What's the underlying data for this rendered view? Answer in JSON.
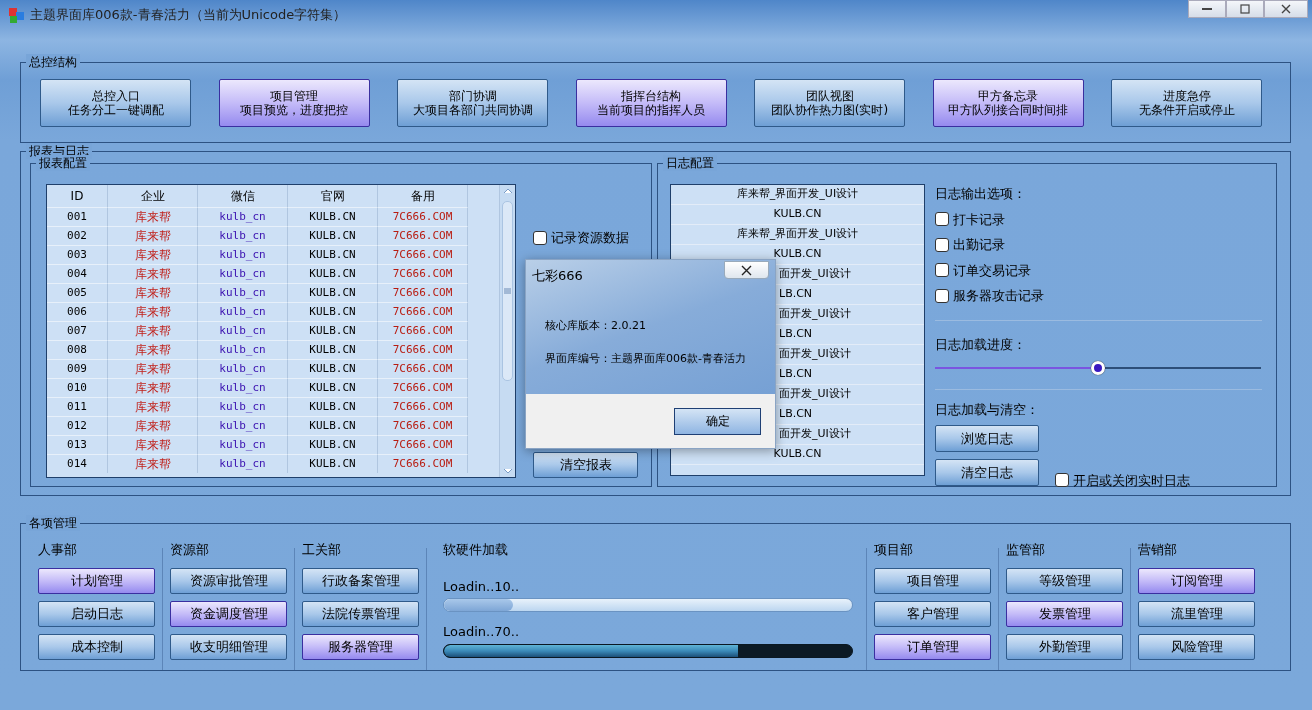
{
  "window": {
    "title": "主题界面库006款-青春活力（当前为Unicode字符集）"
  },
  "top_group": {
    "title": "总控结构",
    "buttons": [
      {
        "line1": "总控入口",
        "line2": "任务分工一键调配",
        "highlighted": false
      },
      {
        "line1": "项目管理",
        "line2": "项目预览，进度把控",
        "highlighted": true
      },
      {
        "line1": "部门协调",
        "line2": "大项目各部门共同协调",
        "highlighted": false
      },
      {
        "line1": "指挥台结构",
        "line2": "当前项目的指挥人员",
        "highlighted": true
      },
      {
        "line1": "团队视图",
        "line2": "团队协作热力图(实时)",
        "highlighted": false
      },
      {
        "line1": "甲方备忘录",
        "line2": "甲方队列接合同时间排",
        "highlighted": true
      },
      {
        "line1": "进度急停",
        "line2": "无条件开启或停止",
        "highlighted": false
      }
    ]
  },
  "report_log": {
    "title": "报表与日志",
    "report": {
      "title": "报表配置",
      "table": {
        "columns": [
          "ID",
          "企业",
          "微信",
          "官网",
          "备用"
        ],
        "rows": [
          [
            "001",
            "库来帮",
            "kulb_cn",
            "KULB.CN",
            "7C666.COM"
          ],
          [
            "002",
            "库来帮",
            "kulb_cn",
            "KULB.CN",
            "7C666.COM"
          ],
          [
            "003",
            "库来帮",
            "kulb_cn",
            "KULB.CN",
            "7C666.COM"
          ],
          [
            "004",
            "库来帮",
            "kulb_cn",
            "KULB.CN",
            "7C666.COM"
          ],
          [
            "005",
            "库来帮",
            "kulb_cn",
            "KULB.CN",
            "7C666.COM"
          ],
          [
            "006",
            "库来帮",
            "kulb_cn",
            "KULB.CN",
            "7C666.COM"
          ],
          [
            "007",
            "库来帮",
            "kulb_cn",
            "KULB.CN",
            "7C666.COM"
          ],
          [
            "008",
            "库来帮",
            "kulb_cn",
            "KULB.CN",
            "7C666.COM"
          ],
          [
            "009",
            "库来帮",
            "kulb_cn",
            "KULB.CN",
            "7C666.COM"
          ],
          [
            "010",
            "库来帮",
            "kulb_cn",
            "KULB.CN",
            "7C666.COM"
          ],
          [
            "011",
            "库来帮",
            "kulb_cn",
            "KULB.CN",
            "7C666.COM"
          ],
          [
            "012",
            "库来帮",
            "kulb_cn",
            "KULB.CN",
            "7C666.COM"
          ],
          [
            "013",
            "库来帮",
            "kulb_cn",
            "KULB.CN",
            "7C666.COM"
          ],
          [
            "014",
            "库来帮",
            "kulb_cn",
            "KULB.CN",
            "7C666.COM"
          ]
        ]
      },
      "checkboxes": [
        {
          "label": "记录资源数据",
          "checked": false
        }
      ],
      "clear_button": "清空报表"
    },
    "log": {
      "title": "日志配置",
      "list": [
        {
          "text": "库来帮_界面开发_UI设计",
          "kind": "full"
        },
        {
          "text": "KULB.CN",
          "kind": "full"
        },
        {
          "text": "库来帮_界面开发_UI设计",
          "kind": "full"
        },
        {
          "text": "KULB.CN",
          "kind": "full"
        },
        {
          "text": "面开发_UI设计",
          "kind": "partial"
        },
        {
          "text": "LB.CN",
          "kind": "partial"
        },
        {
          "text": "面开发_UI设计",
          "kind": "partial"
        },
        {
          "text": "LB.CN",
          "kind": "partial"
        },
        {
          "text": "面开发_UI设计",
          "kind": "partial"
        },
        {
          "text": "LB.CN",
          "kind": "partial"
        },
        {
          "text": "面开发_UI设计",
          "kind": "partial"
        },
        {
          "text": "LB.CN",
          "kind": "partial"
        },
        {
          "text": "面开发_UI设计",
          "kind": "partial"
        },
        {
          "text": "KULB.CN",
          "kind": "full"
        }
      ],
      "output_title": "日志输出选项：",
      "options": [
        {
          "label": "打卡记录",
          "checked": false
        },
        {
          "label": "出勤记录",
          "checked": false
        },
        {
          "label": "订单交易记录",
          "checked": false
        },
        {
          "label": "服务器攻击记录",
          "checked": false
        }
      ],
      "progress_title": "日志加载进度：",
      "slider": {
        "level": 0.5
      },
      "load_title": "日志加载与清空：",
      "buttons": [
        "浏览日志",
        "清空日志"
      ],
      "realtime": {
        "label": "开启或关闭实时日志",
        "checked": false
      }
    }
  },
  "management": {
    "title": "各项管理",
    "left_departments": [
      {
        "name": "人事部",
        "buttons": [
          {
            "label": "计划管理",
            "highlighted": true
          },
          {
            "label": "启动日志",
            "highlighted": false
          },
          {
            "label": "成本控制",
            "highlighted": false
          }
        ]
      },
      {
        "name": "资源部",
        "buttons": [
          {
            "label": "资源审批管理",
            "highlighted": false
          },
          {
            "label": "资金调度管理",
            "highlighted": true
          },
          {
            "label": "收支明细管理",
            "highlighted": false
          }
        ]
      },
      {
        "name": "工关部",
        "buttons": [
          {
            "label": "行政备案管理",
            "highlighted": false
          },
          {
            "label": "法院传票管理",
            "highlighted": false
          },
          {
            "label": "服务器管理",
            "highlighted": true
          }
        ]
      }
    ],
    "loading": {
      "title": "软硬件加载",
      "bars": [
        {
          "label": "Loadin..10..",
          "level": 0.17,
          "kind": "light"
        },
        {
          "label": "Loadin..70..",
          "level": 0.72,
          "kind": "dark"
        }
      ]
    },
    "right_departments": [
      {
        "name": "项目部",
        "buttons": [
          {
            "label": "项目管理",
            "highlighted": false
          },
          {
            "label": "客户管理",
            "highlighted": false
          },
          {
            "label": "订单管理",
            "highlighted": true
          }
        ]
      },
      {
        "name": "监管部",
        "buttons": [
          {
            "label": "等级管理",
            "highlighted": false
          },
          {
            "label": "发票管理",
            "highlighted": true
          },
          {
            "label": "外勤管理",
            "highlighted": false
          }
        ]
      },
      {
        "name": "营销部",
        "buttons": [
          {
            "label": "订阅管理",
            "highlighted": true
          },
          {
            "label": "流里管理",
            "highlighted": false
          },
          {
            "label": "风险管理",
            "highlighted": false
          }
        ]
      }
    ]
  },
  "dialog": {
    "title": "七彩666",
    "lines": [
      "核心库版本：2.0.21",
      "界面库编号：主题界面库006款-青春活力"
    ],
    "ok": "确定"
  }
}
